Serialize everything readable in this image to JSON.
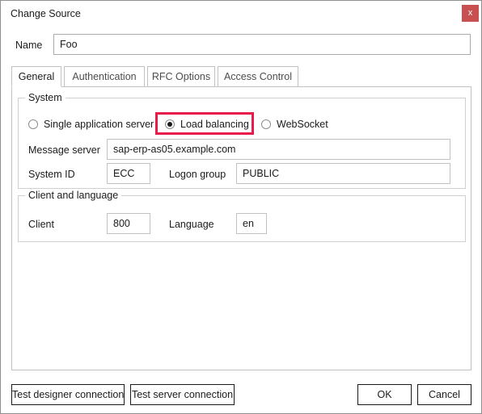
{
  "window": {
    "title": "Change Source",
    "close_label": "x",
    "close_icon": "close-icon",
    "accent_red": "#c85050",
    "highlight_red": "#e81b4b"
  },
  "name_row": {
    "label": "Name",
    "value": "Foo",
    "placeholder": ""
  },
  "tabs": [
    {
      "label": "General",
      "active": true
    },
    {
      "label": "Authentication",
      "active": false
    },
    {
      "label": "RFC Options",
      "active": false
    },
    {
      "label": "Access Control",
      "active": false
    }
  ],
  "system_group": {
    "legend": "System",
    "radios": [
      {
        "label": "Single application server",
        "checked": false
      },
      {
        "label": "Load balancing",
        "checked": true
      },
      {
        "label": "WebSocket",
        "checked": false
      }
    ],
    "fields": {
      "message_server": {
        "label": "Message server",
        "value": "sap-erp-as05.example.com",
        "placeholder": ""
      },
      "system_id": {
        "label": "System ID",
        "value": "ECC",
        "placeholder": ""
      },
      "logon_group": {
        "label": "Logon group",
        "value": "PUBLIC",
        "placeholder": ""
      }
    }
  },
  "client_group": {
    "legend": "Client and language",
    "fields": {
      "client": {
        "label": "Client",
        "value": "800",
        "placeholder": ""
      },
      "language": {
        "label": "Language",
        "value": "en",
        "placeholder": ""
      }
    }
  },
  "footer": {
    "test_designer_connection": "Test designer connection",
    "test_server_connection": "Test server connection",
    "ok": "OK",
    "cancel": "Cancel"
  }
}
